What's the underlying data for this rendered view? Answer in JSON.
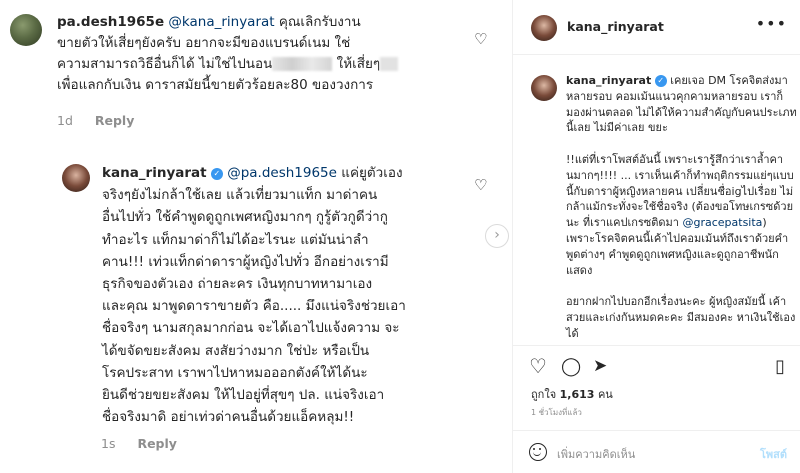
{
  "comments": [
    {
      "username": "pa.desh1965e",
      "mention": "@kana_rinyarat",
      "lines": [
        "คุณเลิกรับงาน",
        "ขายตัวให้เสี่ยๆยังครับ อยากจะมีของแบรนด์เนม ใช่",
        "ความสามารถวิธีอื่นก็ได้ ไม่ใช่ไปนอน",
        "ให้เสี่ยๆ",
        "เพื่อแลกกับเงิน ดาราสมัยนี้ขายตัวร้อยละ80 ของวงการ"
      ],
      "time": "1d",
      "reply_label": "Reply"
    },
    {
      "username": "kana_rinyarat",
      "mention": "@pa.desh1965e",
      "lines": [
        "แค่ยูตัวเอง",
        "จริงๆยังไม่กล้าใช้เลย แล้วเที่ยวมาแท็ก มาด่าคน",
        "อื่นไปทั่ว ใช้คำพูดดูถูกเพศหญิงมากๆ กูรู้ตัวกูดีว่ากู",
        "ทำอะไร แท็กมาด่าก็ไม่ได้อะไรนะ แต่มันน่าลำ",
        "คาน!!! เท่วแท็กด่าดาราผู้หญิงไปทั่ว อีกอย่างเรามี",
        "ธุรกิจของตัวเอง ถ่ายละคร เงินทุกบาทหามาเอง",
        "และคุณ มาพูดดาราขายตัว คือ..... มึงแน่จริงช่วยเอา",
        "ชื่อจริงๆ นามสกุลมากก่อน จะได้เอาไปแจ้งความ จะ",
        "ได้ขจัดขยะสังคม สงสัยว่างมาก ใช่ป่ะ หรือเป็น",
        "โรคประสาท เราพาไปหาหมอออกตังค์ให้ได้นะ",
        "ยินดีช่วยขยะสังคม ให้ไปอยู่ที่สุขๆ ปล. แน่จริงเอา",
        "ชื่อจริงมาดิ อย่าเท่วด่าคนอื่นด้วยแอ็คหลุม!!"
      ],
      "time": "1s",
      "reply_label": "Reply"
    }
  ],
  "panel": {
    "username": "kana_rinyarat",
    "more_label": "•••",
    "caption_para1": "เคยเจอ DM โรคจิตส่งมาหลายรอบ คอมเม้นแนวคุกคามหลายรอบ เราก็มองผ่านตลอด ไม่ได้ให้ความสำคัญกับคนประเภทนี้เลย ไม่มีค่าเลย ขยะ",
    "caption_para2a": "!!แต่ที่เราโพสต์อันนี้ เพราะเรารู้สึกว่าเราล้ำคานมากๆ!!!! ... เราเห็นเค้าก็ทำพฤติกรรมแย่ๆแบบนี้กับดาราผู้หญิงหลายคน เปลี่ยนชื่อigไปเรื่อย ไม่กล้าแม้กระทั่งจะใช้ชื่อจริง (ต้องขอโทษเกรซด้วยนะ ที่เราแคปเกรซติดมา ",
    "caption_mention": "@gracepatsita",
    "caption_para2b": ") เพราะโรคจิตคนนี้เค้าไปคอมเม้นท์ถึงเราด้วยคำพูดต่างๆ คำพูดดูถูกเพศหญิงและดูถูกอาชีพนักแสดง",
    "caption_para3": "อยากฝากไปบอกอีกเรื่องนะคะ ผู้หญิงสมัยนี้ เค้าสวยและเก่งกันหมดคะคะ มีสมองคะ หาเงินใช้เองได้",
    "likes_prefix": "ถูกใจ",
    "likes_count": "1,613",
    "likes_suffix": "คน",
    "time": "1 ชั่วโมงที่แล้ว",
    "comment_placeholder": "เพิ่มความคิดเห็น",
    "post_label": "โพสต์"
  },
  "icons": {
    "heart": "heart-icon",
    "comment": "comment-icon",
    "share": "share-icon",
    "bookmark": "bookmark-icon",
    "emoji": "emoji-icon",
    "next": "chevron-right-icon",
    "more": "more-icon",
    "verified": "verified-badge-icon"
  },
  "colors": {
    "link": "#00376b",
    "verified": "#3897f0",
    "muted": "#8e8e8e",
    "post_disabled": "#b2dffc"
  }
}
